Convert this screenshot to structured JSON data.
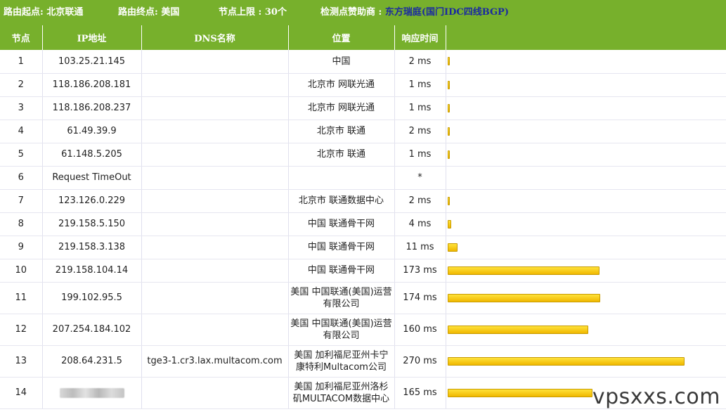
{
  "header": {
    "origin": "路由起点: 北京联通",
    "destination": "路由终点: 美国",
    "node_limit": "节点上限 : 30个",
    "sponsor_label": "检测点赞助商 :",
    "sponsor_name": "东方瑞庭",
    "sponsor_extra": "(国门IDC四线BGP)"
  },
  "columns": [
    "节点",
    "IP地址",
    "DNS名称",
    "位置",
    "响应时间",
    ""
  ],
  "rows": [
    {
      "node": "1",
      "ip": "103.25.21.145",
      "dns": "",
      "location": "中国",
      "time": "2 ms",
      "ms": 2
    },
    {
      "node": "2",
      "ip": "118.186.208.181",
      "dns": "",
      "location": "北京市 网联光通",
      "time": "1 ms",
      "ms": 1
    },
    {
      "node": "3",
      "ip": "118.186.208.237",
      "dns": "",
      "location": "北京市 网联光通",
      "time": "1 ms",
      "ms": 1
    },
    {
      "node": "4",
      "ip": "61.49.39.9",
      "dns": "",
      "location": "北京市 联通",
      "time": "2 ms",
      "ms": 2
    },
    {
      "node": "5",
      "ip": "61.148.5.205",
      "dns": "",
      "location": "北京市 联通",
      "time": "1 ms",
      "ms": 1
    },
    {
      "node": "6",
      "ip": "Request TimeOut",
      "dns": "",
      "location": "",
      "time": "*",
      "ms": 0
    },
    {
      "node": "7",
      "ip": "123.126.0.229",
      "dns": "",
      "location": "北京市 联通数据中心",
      "time": "2 ms",
      "ms": 2
    },
    {
      "node": "8",
      "ip": "219.158.5.150",
      "dns": "",
      "location": "中国 联通骨干网",
      "time": "4 ms",
      "ms": 4
    },
    {
      "node": "9",
      "ip": "219.158.3.138",
      "dns": "",
      "location": "中国 联通骨干网",
      "time": "11 ms",
      "ms": 11
    },
    {
      "node": "10",
      "ip": "219.158.104.14",
      "dns": "",
      "location": "中国 联通骨干网",
      "time": "173 ms",
      "ms": 173
    },
    {
      "node": "11",
      "ip": "199.102.95.5",
      "dns": "",
      "location": "美国 中国联通(美国)运营有限公司",
      "time": "174 ms",
      "ms": 174
    },
    {
      "node": "12",
      "ip": "207.254.184.102",
      "dns": "",
      "location": "美国 中国联通(美国)运营有限公司",
      "time": "160 ms",
      "ms": 160
    },
    {
      "node": "13",
      "ip": "208.64.231.5",
      "dns": "tge3-1.cr3.lax.multacom.com",
      "location": "美国 加利福尼亚州卡宁康特利Multacom公司",
      "time": "270 ms",
      "ms": 270
    },
    {
      "node": "14",
      "ip": "",
      "dns": "",
      "location": "美国 加利福尼亚州洛杉矶MULTACOM数据中心",
      "time": "165 ms",
      "ms": 165
    }
  ],
  "bar_scale_max_ms": 270,
  "colors": {
    "header_green": "#77b02c",
    "bar_yellow": "#f5c800",
    "sponsor_blue": "#1a2aa0"
  },
  "watermark": "vpsxxs.com"
}
